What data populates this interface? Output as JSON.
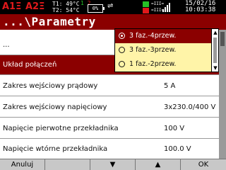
{
  "status_bar": {
    "phase_a1": "A1Ξ",
    "phase_a2": "A2Ξ",
    "t1": "T1: 49°C",
    "t2": "T2: 54°C",
    "battery_label_1": "1",
    "battery_label_2": "2",
    "battery_percent": "0%",
    "usb_icon": "usb-icon",
    "signal_text_1": "=III=",
    "signal_text_2": "=III=",
    "date": "15/02/16",
    "time": "10:03:38",
    "colors": {
      "green": "#26c026",
      "red": "#e0191b",
      "yellow": "#e6d400"
    }
  },
  "title": "...\\Parametry",
  "list": {
    "rows": [
      {
        "label": "...",
        "value": ""
      },
      {
        "label": "Układ połączeń",
        "value": ""
      },
      {
        "label": "Zakres wejściowy prądowy",
        "value": "5 A"
      },
      {
        "label": "Zakres wejściowy napięciowy",
        "value": "3x230.0/400 V"
      },
      {
        "label": "Napięcie pierwotne przekładnika",
        "value": "100 V"
      },
      {
        "label": "Napięcie wtórne przekładnika",
        "value": "100.0 V"
      }
    ]
  },
  "dropdown": {
    "options": [
      {
        "label": "3 faz.-4przew.",
        "selected": true
      },
      {
        "label": "3 faz.-3przew.",
        "selected": false
      },
      {
        "label": "1 faz.-2przew.",
        "selected": false
      }
    ],
    "scroll_up_icon": "▲",
    "scroll_down_icon": "▼"
  },
  "softkeys": {
    "k0": "Anuluj",
    "k1": "",
    "k2": "▼",
    "k3": "▲",
    "k4": "OK"
  },
  "theme": {
    "accent": "#8b0000",
    "dropdown_bg": "#fff4a8",
    "list_bg": "#ffffff",
    "softkey_bg": "#c8c8c8"
  }
}
